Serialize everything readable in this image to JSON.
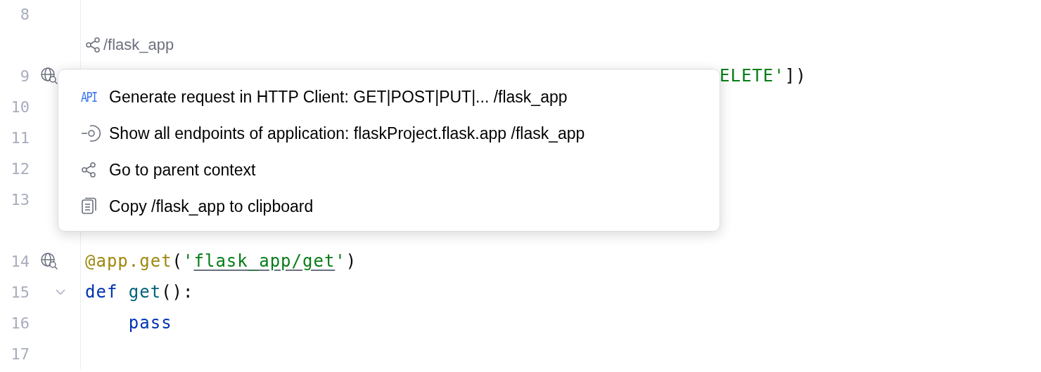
{
  "editor": {
    "rows": [
      {
        "kind": "code",
        "number": "8"
      },
      {
        "kind": "hint",
        "texts": [
          "/flask_app"
        ]
      },
      {
        "kind": "code",
        "number": "9",
        "has_endpoint": true,
        "covered": true,
        "segments": [
          {
            "text": "ELETE'",
            "kind": "string"
          },
          {
            "text": "])",
            "kind": "plain"
          }
        ]
      },
      {
        "kind": "code",
        "number": "10"
      },
      {
        "kind": "code",
        "number": "11"
      },
      {
        "kind": "code",
        "number": "12"
      },
      {
        "kind": "code",
        "number": "13"
      },
      {
        "kind": "blank"
      },
      {
        "kind": "code",
        "number": "14",
        "has_endpoint": true,
        "segments": [
          {
            "text": "@app.get",
            "kind": "decorator"
          },
          {
            "text": "(",
            "kind": "plain"
          },
          {
            "text": "'",
            "kind": "string"
          },
          {
            "text": "flask_app/get",
            "kind": "link"
          },
          {
            "text": "'",
            "kind": "string"
          },
          {
            "text": ")",
            "kind": "plain"
          }
        ]
      },
      {
        "kind": "code",
        "number": "15",
        "foldable": true,
        "segments": [
          {
            "text": "def ",
            "kind": "keyword"
          },
          {
            "text": "get",
            "kind": "function"
          },
          {
            "text": "():",
            "kind": "plain"
          }
        ]
      },
      {
        "kind": "code",
        "number": "16",
        "segments": [
          {
            "text": "    pass",
            "kind": "keyword"
          }
        ]
      },
      {
        "kind": "code",
        "number": "17"
      }
    ]
  },
  "popup": {
    "items": [
      {
        "kind": "api",
        "badge": "API",
        "label": "Generate request in HTTP Client: GET|POST|PUT|... /flask_app"
      },
      {
        "kind": "endpoints",
        "label": "Show all endpoints of application: flaskProject.flask.app /flask_app"
      },
      {
        "kind": "share",
        "label": "Go to parent context"
      },
      {
        "kind": "copy",
        "label": "Copy /flask_app to clipboard"
      }
    ]
  }
}
